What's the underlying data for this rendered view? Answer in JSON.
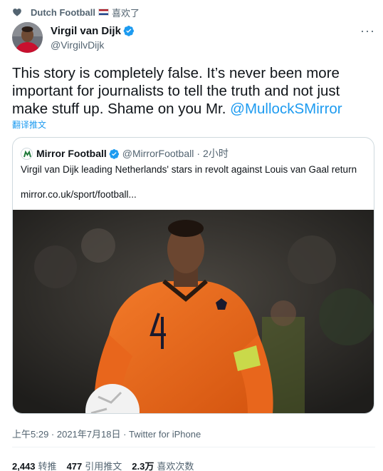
{
  "liked": {
    "user": "Dutch Football",
    "suffix": "喜欢了",
    "flag_colors": [
      "#ae1c28",
      "#ffffff",
      "#21468b"
    ]
  },
  "author": {
    "name": "Virgil van Dijk",
    "handle": "@VirgilvDijk",
    "verified": true
  },
  "more_label": "···",
  "tweet": {
    "text_before": "This story is completely false. It’s never been more important for journalists to tell the truth and not just make stuff up. Shame on you Mr. ",
    "mention": "@MullockSMirror",
    "translate": "翻译推文"
  },
  "quote": {
    "name": "Mirror Football",
    "handle": "@MirrorFootball",
    "dot": "·",
    "time": "2小时",
    "text": "Virgil van Dijk leading Netherlands' stars in revolt against Louis van Gaal return",
    "link": "mirror.co.uk/sport/football..."
  },
  "meta": {
    "time": "上午5:29 · 2021年7月18日 · ",
    "source": "Twitter for iPhone"
  },
  "stats": [
    {
      "num": "2,443",
      "label": "转推"
    },
    {
      "num": "477",
      "label": "引用推文"
    },
    {
      "num": "2.3万",
      "label": "喜欢次数"
    }
  ],
  "colors": {
    "accent": "#1d9bf0",
    "jersey": "#f26a1b",
    "muted": "#536471"
  }
}
